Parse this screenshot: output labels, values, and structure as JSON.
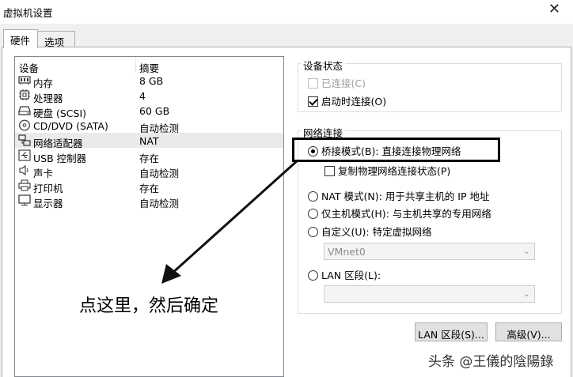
{
  "window": {
    "title": "虚拟机设置",
    "close_glyph": "✕"
  },
  "tabs": [
    {
      "label": "硬件",
      "active": true
    },
    {
      "label": "选项",
      "active": false
    }
  ],
  "device_list": {
    "header_device": "设备",
    "header_summary": "摘要",
    "items": [
      {
        "name": "内存",
        "summary": "8 GB",
        "icon": "memory-icon"
      },
      {
        "name": "处理器",
        "summary": "4",
        "icon": "cpu-icon"
      },
      {
        "name": "硬盘 (SCSI)",
        "summary": "60 GB",
        "icon": "hard-disk-icon"
      },
      {
        "name": "CD/DVD (SATA)",
        "summary": "自动检测",
        "icon": "cd-dvd-icon"
      },
      {
        "name": "网络适配器",
        "summary": "NAT",
        "icon": "network-adapter-icon",
        "selected": true
      },
      {
        "name": "USB 控制器",
        "summary": "存在",
        "icon": "usb-icon"
      },
      {
        "name": "声卡",
        "summary": "自动检测",
        "icon": "speaker-icon"
      },
      {
        "name": "打印机",
        "summary": "存在",
        "icon": "printer-icon"
      },
      {
        "name": "显示器",
        "summary": "自动检测",
        "icon": "monitor-icon"
      }
    ]
  },
  "device_status": {
    "group_label": "设备状态",
    "connected_label": "已连接(C)",
    "connect_on_start_label": "启动时连接(O)",
    "connected_checked": false,
    "connect_on_start_checked": true
  },
  "network": {
    "group_label": "网络连接",
    "bridged_label": "桥接模式(B): 直接连接物理网络",
    "replicate_label": "复制物理网络连接状态(P)",
    "nat_label": "NAT 模式(N): 用于共享主机的 IP 地址",
    "host_only_label": "仅主机模式(H): 与主机共享的专用网络",
    "custom_label": "自定义(U): 特定虚拟网络",
    "custom_value": "VMnet0",
    "lan_label": "LAN 区段(L):",
    "lan_value": "",
    "selected": "bridged"
  },
  "buttons": {
    "lan_segments": "LAN 区段(S)...",
    "advanced": "高级(V)..."
  },
  "annotation": {
    "text": "点这里，然后确定"
  },
  "watermark": "头条 @王儀的陰陽錄",
  "colors": {
    "panel_bg": "#ffffff",
    "window_bg": "#f0f0f0",
    "selected_row": "#eaeaea",
    "disabled_text": "#9d9d9d"
  }
}
